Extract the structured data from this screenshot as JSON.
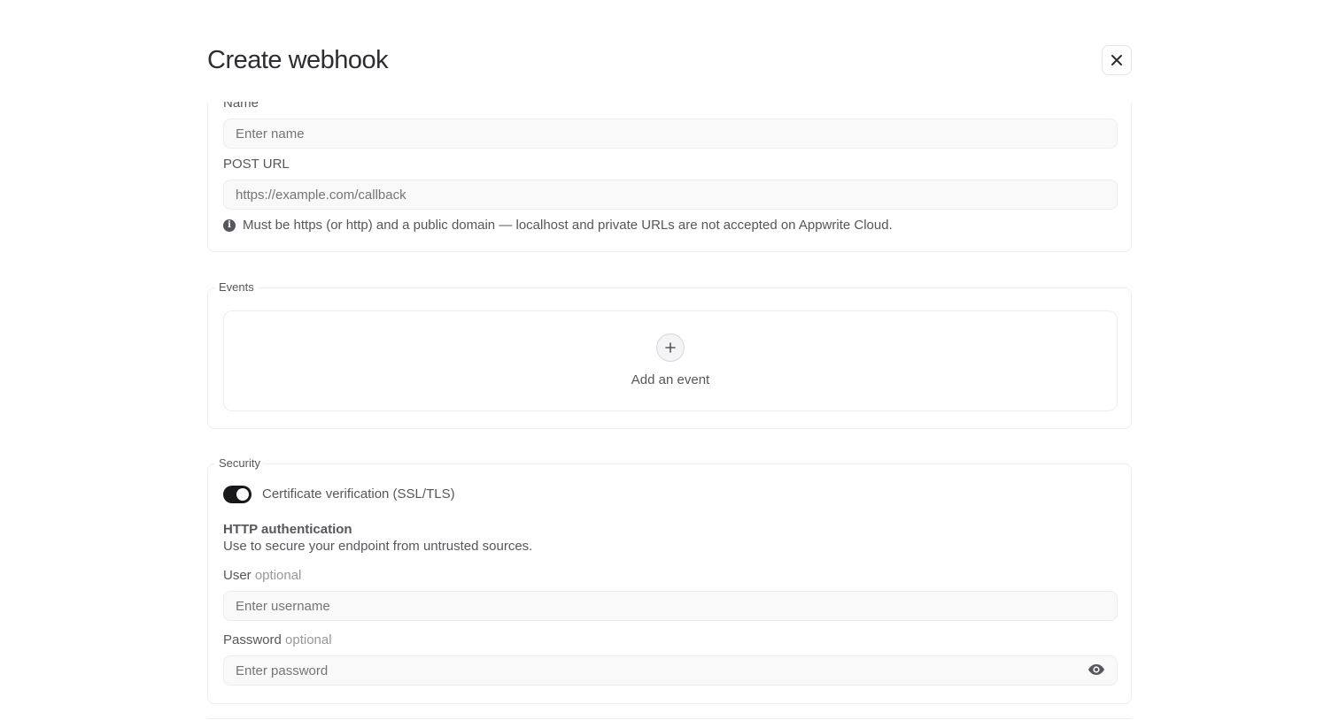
{
  "modal": {
    "title": "Create webhook",
    "close_icon": "close-icon"
  },
  "details": {
    "name_label": "Name",
    "name_placeholder": "Enter name",
    "url_label": "POST URL",
    "url_placeholder": "https://example.com/callback",
    "url_hint": "Must be https (or http) and a public domain — localhost and private URLs are not accepted on Appwrite Cloud.",
    "hint_icon": "info-icon"
  },
  "events": {
    "legend": "Events",
    "add_label": "Add an event",
    "add_icon": "plus-icon"
  },
  "security": {
    "legend": "Security",
    "toggle_label": "Certificate verification (SSL/TLS)",
    "toggle_on": true,
    "auth_title": "HTTP authentication",
    "auth_desc": "Use to secure your endpoint from untrusted sources.",
    "user_label": "User",
    "user_optional": "optional",
    "user_placeholder": "Enter username",
    "password_label": "Password",
    "password_optional": "optional",
    "password_placeholder": "Enter password",
    "eye_icon": "eye-icon"
  }
}
